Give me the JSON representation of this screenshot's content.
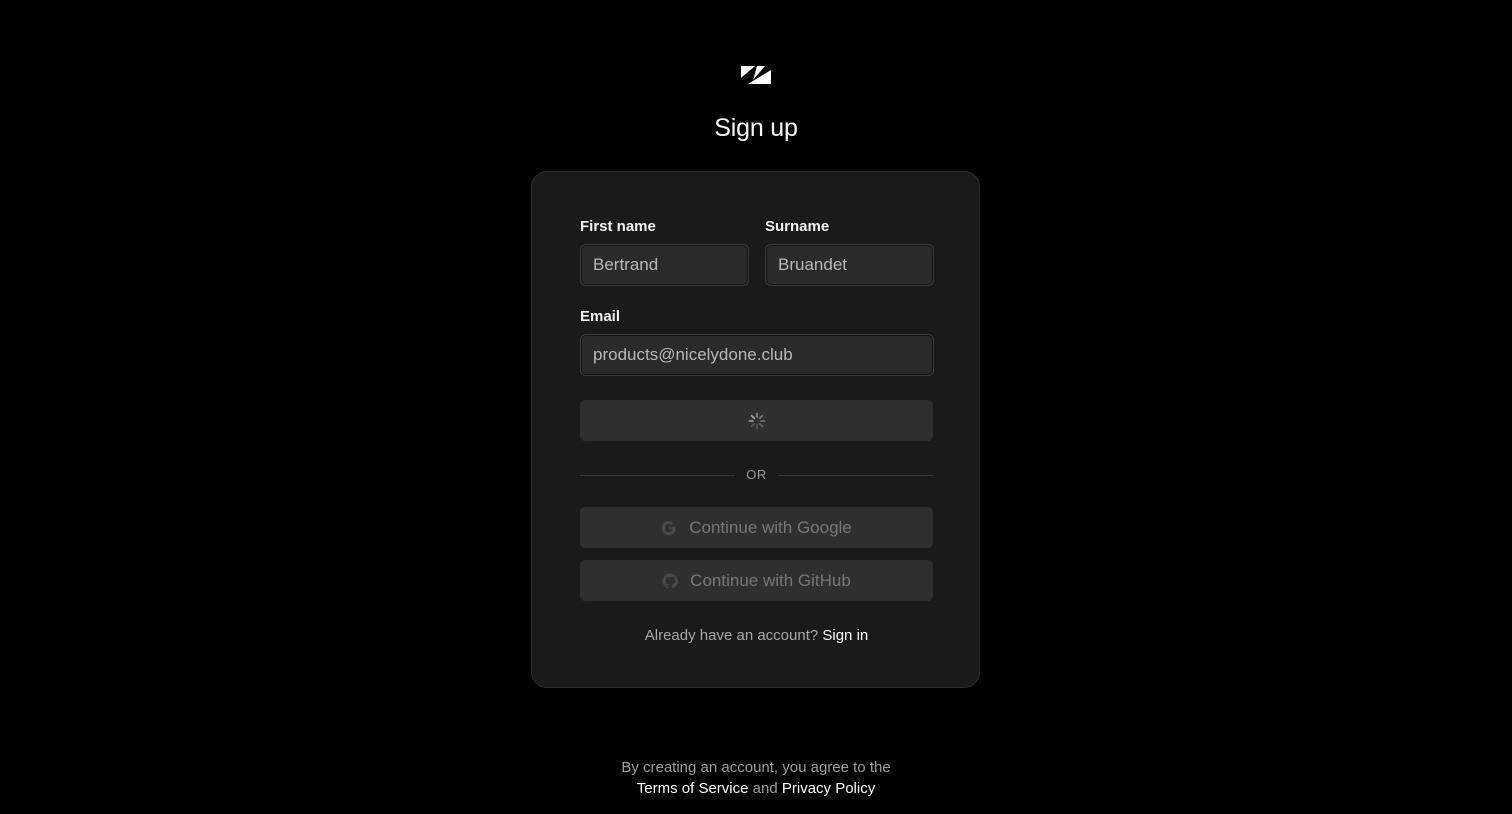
{
  "brand": {
    "logo_icon": "zendesk-style-logo-icon"
  },
  "header": {
    "title": "Sign up"
  },
  "form": {
    "first_name": {
      "label": "First name",
      "value": "Bertrand"
    },
    "surname": {
      "label": "Surname",
      "value": "Bruandet"
    },
    "email": {
      "label": "Email",
      "value": "products@nicelydone.club"
    },
    "submit": {
      "state": "loading",
      "icon": "spinner-icon"
    },
    "divider_text": "OR",
    "google_button": {
      "label": "Continue with Google",
      "icon": "google-icon"
    },
    "github_button": {
      "label": "Continue with GitHub",
      "icon": "github-icon"
    },
    "signin_prompt": "Already have an account?",
    "signin_link": "Sign in"
  },
  "footer": {
    "line1": "By creating an account, you agree to the",
    "terms_link": "Terms of Service",
    "and_text": "and",
    "privacy_link": "Privacy Policy"
  },
  "colors": {
    "background": "#000000",
    "card": "#1a1a1a",
    "input": "#2a2a2a",
    "button": "#2f2f2f"
  }
}
